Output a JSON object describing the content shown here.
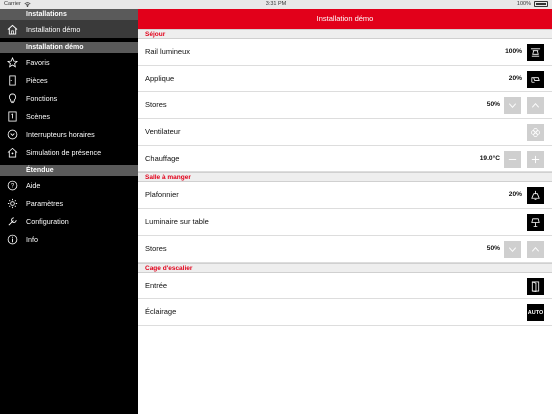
{
  "status_bar": {
    "carrier": "Carrier",
    "time": "3:31 PM",
    "battery": "100%"
  },
  "sidebar": {
    "sections": [
      {
        "header": "Installations",
        "items": [
          {
            "label": "Installation démo",
            "icon": "house-icon",
            "active": true
          }
        ]
      },
      {
        "header": "Installation démo",
        "items": [
          {
            "label": "Favoris",
            "icon": "star-icon"
          },
          {
            "label": "Pièces",
            "icon": "door-icon"
          },
          {
            "label": "Fonctions",
            "icon": "bulb-icon"
          },
          {
            "label": "Scènes",
            "icon": "scenes-icon"
          },
          {
            "label": "Interrupteurs horaires",
            "icon": "clock-icon"
          },
          {
            "label": "Simulation de présence",
            "icon": "presence-house-icon"
          }
        ]
      },
      {
        "header": "Étendue",
        "items": [
          {
            "label": "Aide",
            "icon": "help-icon"
          },
          {
            "label": "Paramètres",
            "icon": "gear-icon"
          },
          {
            "label": "Configuration",
            "icon": "wrench-icon"
          },
          {
            "label": "Info",
            "icon": "info-icon"
          }
        ]
      }
    ]
  },
  "header": {
    "title": "Installation démo"
  },
  "rooms": [
    {
      "name": "Séjour",
      "devices": [
        {
          "name": "Rail lumineux",
          "value": "100%",
          "control": "track-light-icon"
        },
        {
          "name": "Applique",
          "value": "20%",
          "control": "wall-lamp-icon"
        },
        {
          "name": "Stores",
          "value": "50%",
          "control": "up-down"
        },
        {
          "name": "Ventilateur",
          "value": "",
          "control": "fan-icon"
        },
        {
          "name": "Chauffage",
          "value": "19.0°C",
          "control": "minus-plus"
        }
      ]
    },
    {
      "name": "Salle à manger",
      "devices": [
        {
          "name": "Plafonnier",
          "value": "20%",
          "control": "ceiling-lamp-icon"
        },
        {
          "name": "Luminaire sur table",
          "value": "",
          "control": "table-lamp-icon"
        },
        {
          "name": "Stores",
          "value": "50%",
          "control": "up-down"
        }
      ]
    },
    {
      "name": "Cage d'escalier",
      "devices": [
        {
          "name": "Entrée",
          "value": "",
          "control": "door-open-icon"
        },
        {
          "name": "Éclairage",
          "value": "",
          "control": "auto",
          "control_label": "AUTO"
        }
      ]
    }
  ],
  "colors": {
    "accent": "#e2001a",
    "sidebar_bg": "#000000",
    "section_header_bg": "#5a5a5a",
    "room_header_bg": "#eeeeee",
    "disabled_button": "#cfcfcf"
  }
}
